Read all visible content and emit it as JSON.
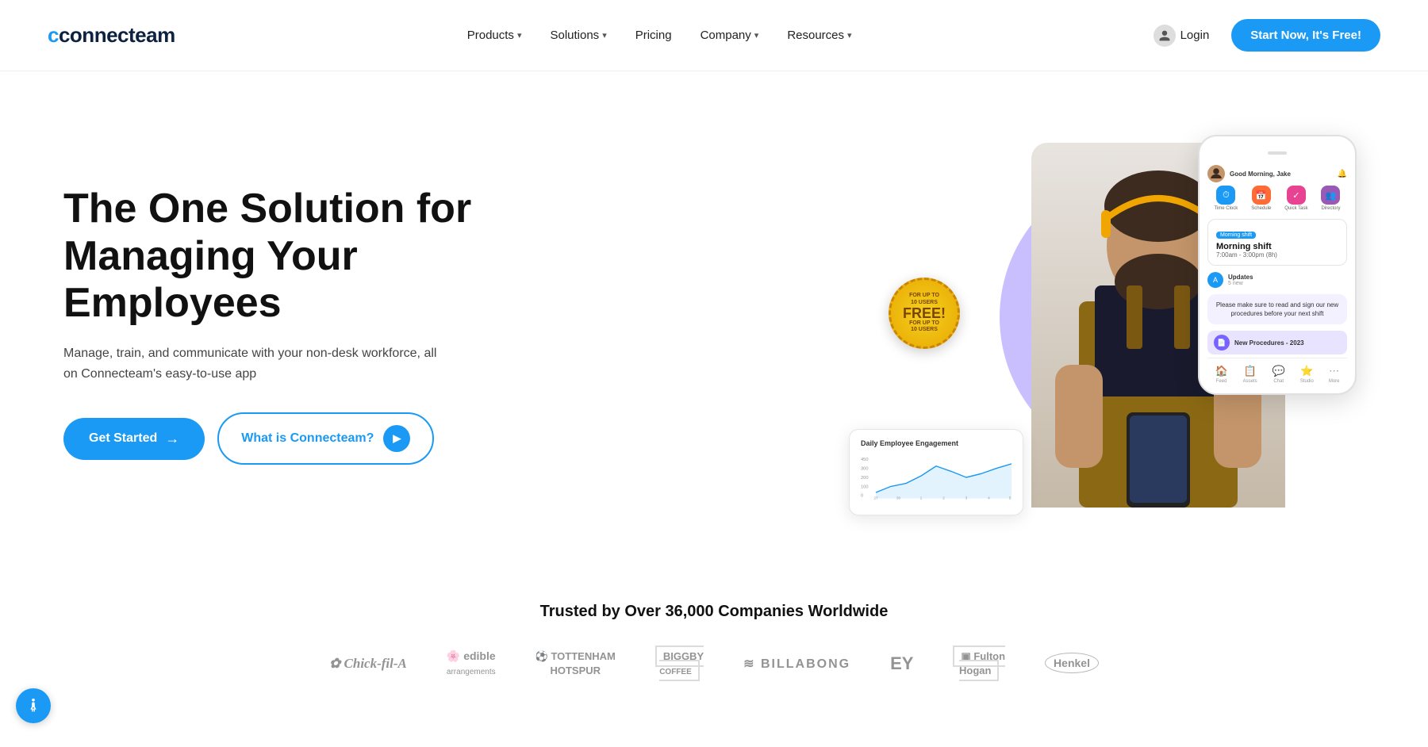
{
  "brand": {
    "name": "connecteam",
    "logo_c": "c"
  },
  "navbar": {
    "links": [
      {
        "label": "Products",
        "has_dropdown": true
      },
      {
        "label": "Solutions",
        "has_dropdown": true
      },
      {
        "label": "Pricing",
        "has_dropdown": false
      },
      {
        "label": "Company",
        "has_dropdown": true
      },
      {
        "label": "Resources",
        "has_dropdown": true
      }
    ],
    "login_label": "Login",
    "cta_label": "Start Now, It's Free!"
  },
  "hero": {
    "title_line1": "The One Solution for",
    "title_line2": "Managing Your Employees",
    "subtitle": "Manage, train, and communicate with your non-desk workforce, all on Connecteam's easy-to-use app",
    "btn_get_started": "Get Started",
    "btn_what": "What is Connecteam?",
    "free_badge_main": "FREE!",
    "free_badge_top": "FOR UP TO 10 USERS",
    "free_badge_bottom": "FOR UP TO 10 USERS"
  },
  "phone": {
    "greeting": "Good Morning, Jake",
    "icons": [
      {
        "label": "Time Clock",
        "color": "#1a9af5",
        "symbol": "⏱"
      },
      {
        "label": "Schedule",
        "color": "#ff6b35",
        "symbol": "📅"
      },
      {
        "label": "Quick Task",
        "color": "#e84393",
        "symbol": "✓"
      },
      {
        "label": "Directory",
        "color": "#9b59b6",
        "symbol": "👥"
      }
    ],
    "shift_badge": "Morning shift",
    "shift_title": "Morning shift",
    "shift_time": "7:00am - 3:00pm (8h)",
    "update_label": "Updates",
    "update_sub": "5 new",
    "message": "Please make sure to read and sign our new procedures before your next shift",
    "doc_label": "New Procedures - 2023",
    "bottom_nav": [
      "Feed",
      "Assets",
      "Chat",
      "Studio",
      "More"
    ]
  },
  "chart": {
    "title": "Daily Employee Engagement",
    "y_labels": [
      "450",
      "300",
      "200",
      "100",
      "0"
    ],
    "x_labels": [
      "27",
      "30",
      "1",
      "2",
      "3",
      "4",
      "5"
    ]
  },
  "trusted": {
    "title": "Trusted by Over 36,000 Companies Worldwide",
    "logos": [
      "Chick-fil-A",
      "edible arrangements",
      "TOTTENHAM HOTSPUR",
      "BIGGBY COFFEE",
      "BILLABONG",
      "EY",
      "Fulton Hogan",
      "Henkel"
    ]
  }
}
